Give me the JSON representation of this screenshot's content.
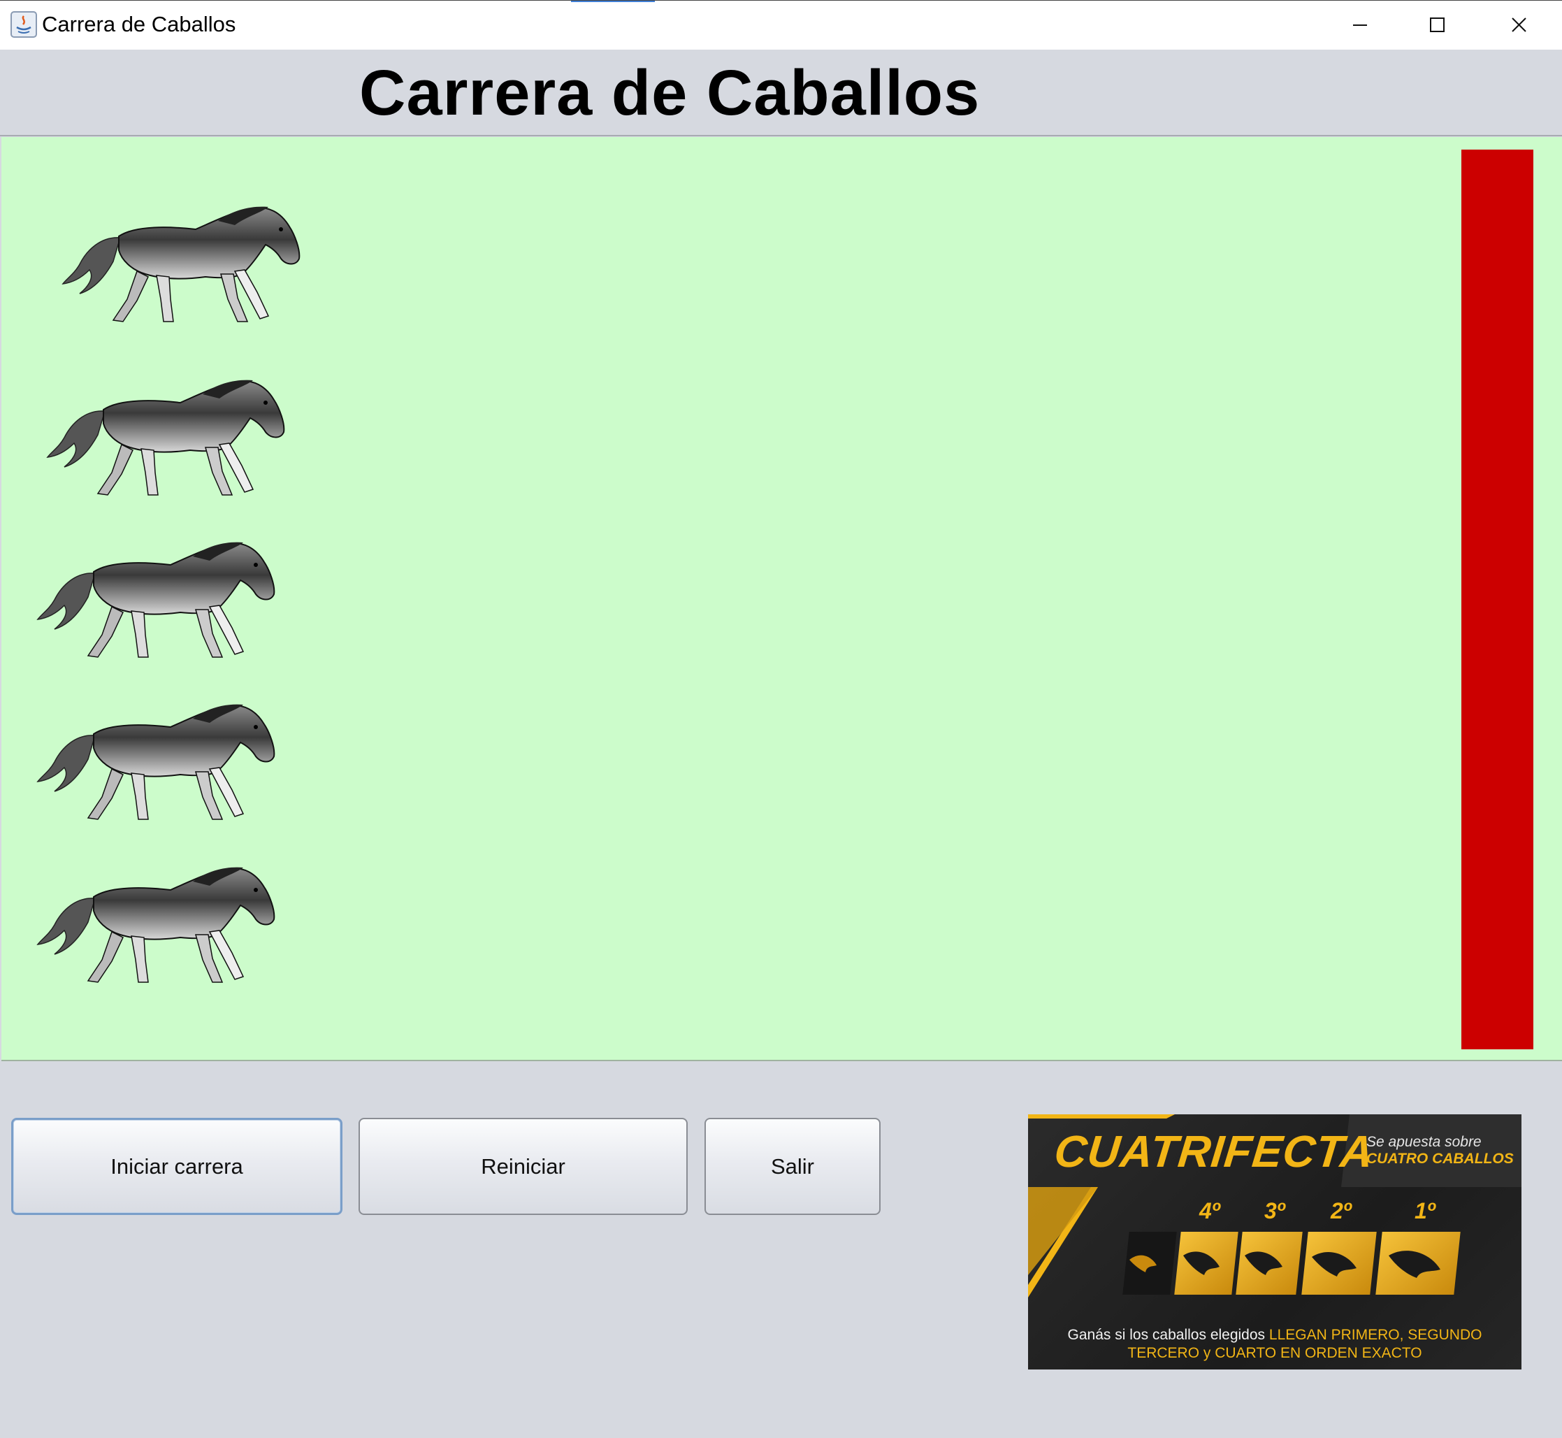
{
  "window": {
    "title": "Carrera de Caballos"
  },
  "header": {
    "title": "Carrera de Caballos"
  },
  "track": {
    "horses": [
      "horse-1",
      "horse-2",
      "horse-3",
      "horse-4",
      "horse-5"
    ],
    "finish_line_color": "#cc0000",
    "background_color": "#ccfccb"
  },
  "controls": {
    "start_label": "Iniciar carrera",
    "restart_label": "Reiniciar",
    "exit_label": "Salir"
  },
  "banner": {
    "headline": "CUATRIFECTA",
    "sub_line_1": "Se apuesta sobre",
    "sub_line_2": "CUATRO CABALLOS",
    "positions": [
      "4º",
      "3º",
      "2º",
      "1º"
    ],
    "footer_plain": "Ganás si los caballos elegidos ",
    "footer_highlight_1": "LLEGAN PRIMERO, SEGUNDO",
    "footer_highlight_2": "TERCERO y CUARTO EN ORDEN EXACTO",
    "accent_color": "#f2b516"
  }
}
